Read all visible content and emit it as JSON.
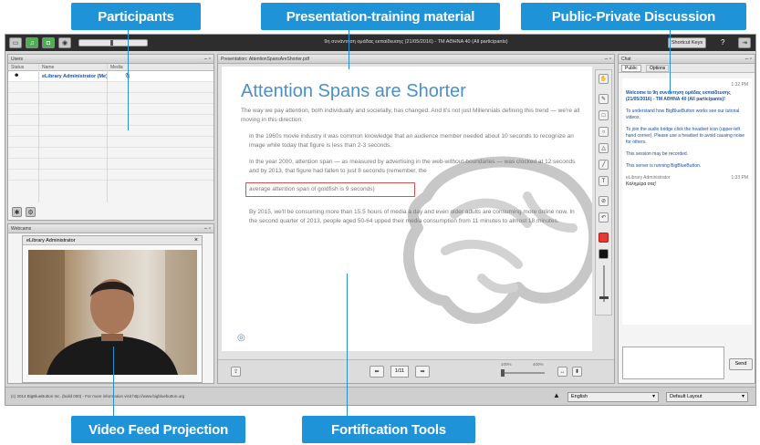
{
  "callouts": {
    "participants": "Participants",
    "presentation": "Presentation-training material",
    "discussion": "Public-Private Discussion",
    "video": "Video Feed Projection",
    "tools": "Fortification Tools"
  },
  "topbar": {
    "title": "9η συνάντηση ομάδας εκπαίδευσης (21/05/2016) - ΤΜ ΑΘΗΝΑ 40 (All participants)",
    "shortcut_label": "Shortcut Keys",
    "help_label": "?"
  },
  "users_panel": {
    "title": "Users",
    "col_status": "Status",
    "col_name": "Name",
    "col_media": "Media",
    "user_name": "eLibrary Administrator (Me)"
  },
  "webcam_panel": {
    "title": "Webcams",
    "feed_label": "eLibrary Administrator"
  },
  "presentation": {
    "header": "Presentation: ΑttentionSpansAreShorter.pdf",
    "slide_title": "Attention Spans are Shorter",
    "intro": "The way we pay attention, both individually and societally, has changed. And it's not just Millennials defining this trend — we're all moving in this direction:",
    "bullets": [
      "In the 1960s movie industry it was common knowledge that an audience member needed about 10 seconds to recognize an image while today that figure is less than 2-3 seconds.",
      "In the year 2000, attention span — as measured by advertising in the web-without-boundaries — was clocked at 12 seconds and by 2013, that figure had fallen to just 8 seconds (remember, the",
      "average attention span of goldfish is 9 seconds)",
      "By 2015, we'll be consuming more than 15.5 hours of media a day and even older adults are consuming more online now. In the second quarter of 2013, people aged 50-64 upped their media consumption from 11 minutes to almost 18 minutes."
    ],
    "page_indicator": "1/11",
    "zoom_min": "100%",
    "zoom_max": "400%"
  },
  "chat": {
    "title": "Chat",
    "tab_public": "Public",
    "tab_options": "Options",
    "time1": "1:32 PM",
    "welcome": "Welcome to 9η συνάντηση ομάδας εκπαίδευσης (21/05/2016) - ΤΜ ΑΘΗΝΑ 40 (All participants)!",
    "tutorial": "To understand how BigBlueButton works see our tutorial videos.",
    "audio": "To join the audio bridge click the headset icon (upper-left hand corner). Please use a headset to avoid causing noise for others.",
    "recorded": "This session may be recorded.",
    "running": "This server is running BigBlueButton.",
    "sender": "eLibrary Administrator",
    "time2": "1:33 PM",
    "message": "Καλημέρα σας!",
    "send_label": "Send"
  },
  "statusbar": {
    "copyright": "(c) 2014 BigBlueButton Inc. (build 000) - For more information visit http://www.bigbluebutton.org",
    "language": "English",
    "layout": "Default Layout"
  },
  "colors": {
    "accent": "#1f93d8",
    "slide_title": "#4a90c8",
    "highlight_box": "#d9534f",
    "brain_stroke": "#bdbdbd"
  }
}
